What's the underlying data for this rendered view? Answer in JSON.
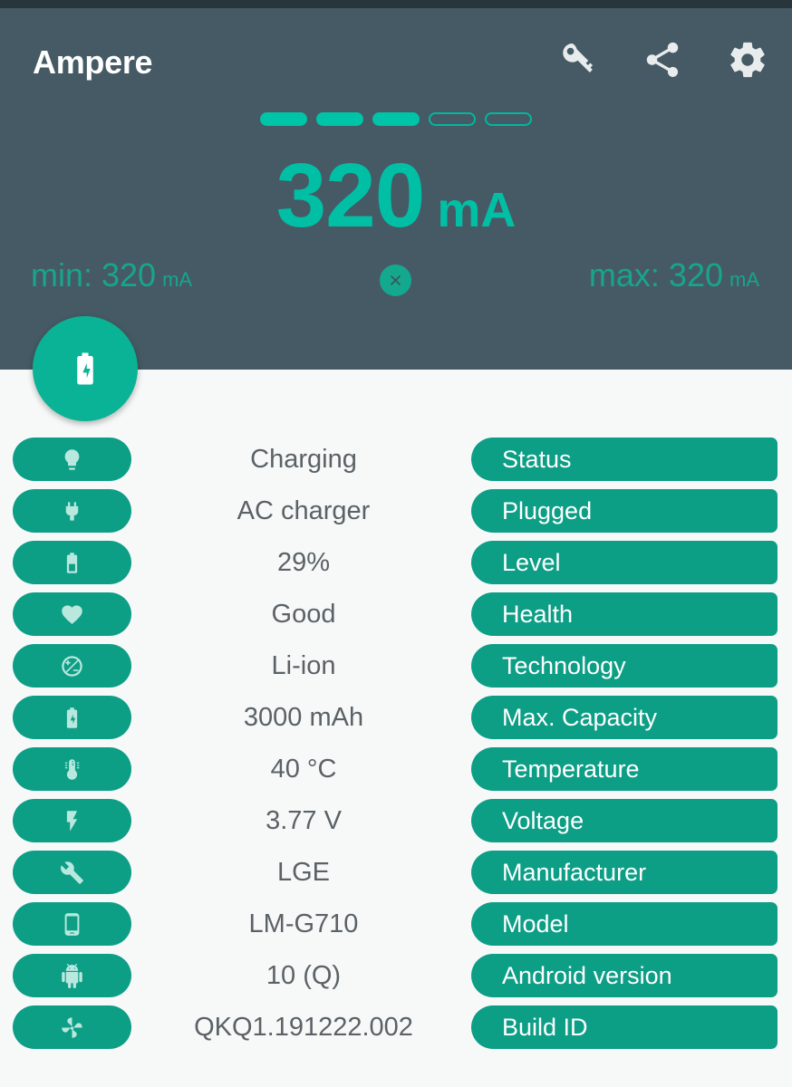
{
  "app": {
    "title": "Ampere",
    "accent_teal": "#0d9e86",
    "accent_bright": "#00bfa5",
    "header_bg": "#455a64",
    "statusbar_bg": "#28363c",
    "page_bg": "#f7f9f9"
  },
  "appbar": {
    "actions": [
      {
        "name": "key-icon",
        "label": "Key"
      },
      {
        "name": "share-icon",
        "label": "Share"
      },
      {
        "name": "gear-icon",
        "label": "Settings"
      }
    ]
  },
  "gauge": {
    "segments": [
      true,
      true,
      true,
      false,
      false
    ],
    "segment_count": 5,
    "segments_filled": 3,
    "value": "320",
    "unit": "mA",
    "min_label": "min:",
    "min_value": "320",
    "min_unit": "mA",
    "max_label": "max:",
    "max_value": "320",
    "max_unit": "mA",
    "reset_button": "reset-button"
  },
  "fab": {
    "name": "battery-charging-fab",
    "icon": "battery-charging-icon"
  },
  "rows": [
    {
      "icon": "bulb-icon",
      "value": "Charging",
      "label": "Status"
    },
    {
      "icon": "plug-icon",
      "value": "AC charger",
      "label": "Plugged"
    },
    {
      "icon": "battery-icon",
      "value": "29%",
      "label": "Level"
    },
    {
      "icon": "heart-icon",
      "value": "Good",
      "label": "Health"
    },
    {
      "icon": "plus-minus-circle-icon",
      "value": "Li-ion",
      "label": "Technology"
    },
    {
      "icon": "battery-charging-icon",
      "value": "3000 mAh",
      "label": "Max. Capacity"
    },
    {
      "icon": "thermometer-icon",
      "value": "40 °C",
      "label": "Temperature"
    },
    {
      "icon": "bolt-icon",
      "value": "3.77 V",
      "label": "Voltage"
    },
    {
      "icon": "wrench-icon",
      "value": "LGE",
      "label": "Manufacturer"
    },
    {
      "icon": "phone-icon",
      "value": "LM-G710",
      "label": "Model"
    },
    {
      "icon": "android-icon",
      "value": "10 (Q)",
      "label": "Android version"
    },
    {
      "icon": "fan-icon",
      "value": "QKQ1.191222.002",
      "label": "Build ID"
    }
  ]
}
